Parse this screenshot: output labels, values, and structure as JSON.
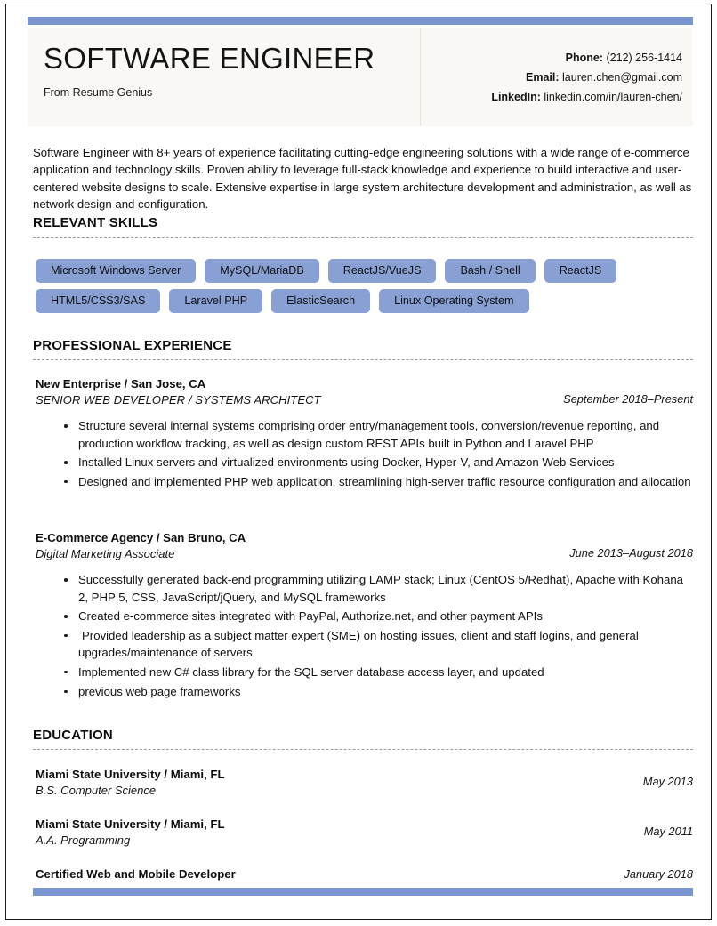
{
  "document": {
    "accent_color": "#7b95d1",
    "pill_color": "#89a0d4",
    "header_bg": "#f9f8f4"
  },
  "header": {
    "name_title": "SOFTWARE ENGINEER",
    "subtitle": "From Resume Genius",
    "contact": [
      {
        "label": "Phone:",
        "value": "(212) 256-1414"
      },
      {
        "label": "Email:",
        "value": "lauren.chen@gmail.com"
      },
      {
        "label": "LinkedIn:",
        "value": "linkedin.com/in/lauren-chen/"
      }
    ]
  },
  "summary": {
    "text": "Software Engineer with 8+ years of experience facilitating cutting-edge engineering solutions with a wide range of e-commerce application and technology skills. Proven ability to leverage full-stack knowledge and experience to build interactive and user-centered website designs to scale. Extensive expertise in large system architecture development and administration, as well as network design and configuration."
  },
  "sections": {
    "skills_heading": "RELEVANT SKILLS",
    "experience_heading": "PROFESSIONAL EXPERIENCE",
    "education_heading": "EDUCATION"
  },
  "skills": {
    "rows": [
      [
        "Microsoft Windows Server",
        "MySQL/MariaDB",
        "ReactJS/VueJS",
        "Bash / Shell",
        "ReactJS"
      ],
      [
        "HTML5/CSS3/SAS",
        "Laravel PHP",
        "ElasticSearch",
        "Linux Operating System"
      ]
    ]
  },
  "experience": {
    "jobs": [
      {
        "employer": "New Enterprise / San Jose, CA",
        "role": "SENIOR WEB DEVELOPER / SYSTEMS ARCHITECT",
        "date": "September 2018–Present",
        "bullets": [
          "Structure several internal systems comprising order entry/management tools, conversion/revenue reporting, and production workflow tracking, as well as design custom REST APIs built in Python and Laravel PHP",
          "Installed Linux servers and virtualized environments using Docker, Hyper-V, and Amazon Web Services",
          "Designed and implemented PHP web application, streamlining high-server traffic resource configuration and allocation"
        ]
      },
      {
        "employer": "E-Commerce Agency / San Bruno, CA",
        "role": "Digital Marketing Associate",
        "date": "June 2013–August 2018",
        "bullets": [
          "Successfully generated back-end programming utilizing LAMP stack; Linux (CentOS 5/Redhat), Apache with Kohana 2, PHP 5, CSS, JavaScript/jQuery, and MySQL frameworks",
          "Created e-commerce sites integrated with PayPal, Authorize.net, and other payment APIs",
          "Provided leadership as a subject matter expert (SME) on hosting issues, client and staff logins, and general upgrades/maintenance of servers",
          "Implemented new C# class library for the SQL server database access layer, and updated",
          "previous web page frameworks"
        ]
      }
    ]
  },
  "education": {
    "items": [
      {
        "school": "Miami State University / Miami, FL",
        "degree": "B.S. Computer Science",
        "date": "May 2013"
      },
      {
        "school": "Miami State University / Miami, FL",
        "degree": "A.A. Programming",
        "date": "May 2011"
      },
      {
        "school": "Certified Web and Mobile Developer",
        "degree": "",
        "date": "January 2018"
      }
    ]
  }
}
